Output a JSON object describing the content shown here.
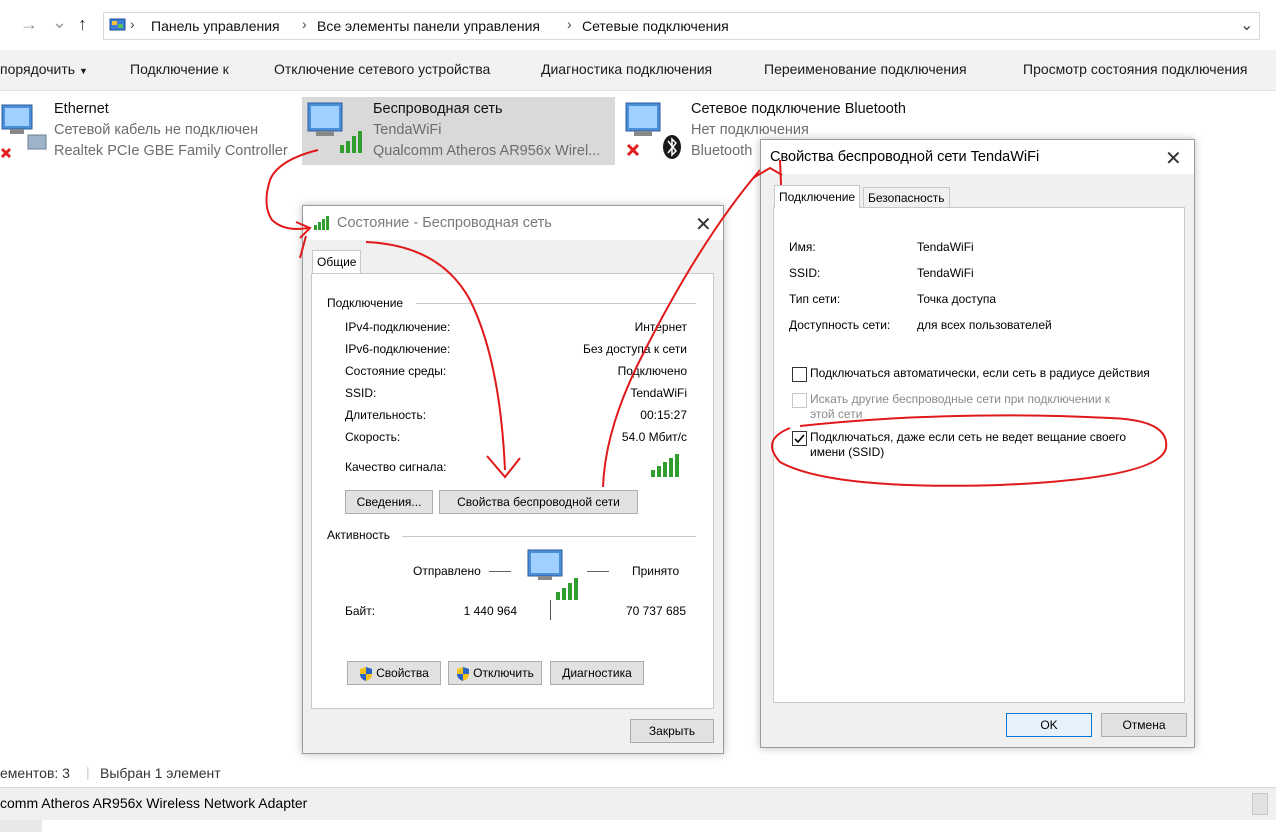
{
  "addressbar": {
    "back_arrow": "→",
    "dropdown": "⌄",
    "up_arrow": "↑",
    "crumbs": [
      "Панель управления",
      "Все элементы панели управления",
      "Сетевые подключения"
    ],
    "separator": "›"
  },
  "toolbar": {
    "organize": "порядочить",
    "connect": "Подключение к",
    "disable": "Отключение сетевого устройства",
    "diagnose": "Диагностика подключения",
    "rename": "Переименование подключения",
    "view_status": "Просмотр состояния подключения"
  },
  "connections": [
    {
      "name": "Ethernet",
      "status": "Сетевой кабель не подключен",
      "device": "Realtek PCIe GBE Family Controller",
      "icon": "ethernet-adapter-icon"
    },
    {
      "name": "Беспроводная сеть",
      "status": "TendaWiFi",
      "device": "Qualcomm Atheros AR956x Wirel...",
      "icon": "wireless-adapter-icon"
    },
    {
      "name": "Сетевое подключение Bluetooth",
      "status": "Нет подключения",
      "device": "Bluetooth",
      "icon": "bluetooth-adapter-icon"
    }
  ],
  "statusbar": {
    "count": "ементов: 3",
    "selected": "Выбран 1 элемент"
  },
  "detailbar": {
    "text": "comm Atheros AR956x Wireless Network Adapter"
  },
  "status_dialog": {
    "title": "Состояние - Беспроводная сеть",
    "tab": "Общие",
    "connection_header": "Подключение",
    "rows": [
      {
        "label": "IPv4-подключение:",
        "value": "Интернет"
      },
      {
        "label": "IPv6-подключение:",
        "value": "Без доступа к сети"
      },
      {
        "label": "Состояние среды:",
        "value": "Подключено"
      },
      {
        "label": "SSID:",
        "value": "TendaWiFi"
      },
      {
        "label": "Длительность:",
        "value": "00:15:27"
      },
      {
        "label": "Скорость:",
        "value": "54.0 Мбит/с"
      }
    ],
    "signal_label": "Качество сигнала:",
    "details_button": "Сведения...",
    "wireless_props_button": "Свойства беспроводной сети",
    "activity_header": "Активность",
    "sent_label": "Отправлено",
    "received_label": "Принято",
    "bytes_label": "Байт:",
    "bytes_sent": "1 440 964",
    "bytes_received": "70 737 685",
    "properties_button": "Свойства",
    "disable_button": "Отключить",
    "diagnose_button": "Диагностика",
    "close_button": "Закрыть"
  },
  "props_dialog": {
    "title": "Свойства беспроводной сети TendaWiFi",
    "tab_connection": "Подключение",
    "tab_security": "Безопасность",
    "rows": [
      {
        "label": "Имя:",
        "value": "TendaWiFi"
      },
      {
        "label": "SSID:",
        "value": "TendaWiFi"
      },
      {
        "label": "Тип сети:",
        "value": "Точка доступа"
      },
      {
        "label": "Доступность сети:",
        "value": "для всех пользователей"
      }
    ],
    "check_auto": "Подключаться автоматически, если сеть в радиусе действия",
    "check_auto_checked": false,
    "check_other_line1": "Искать другие беспроводные сети при подключении к",
    "check_other_line2": "этой сети",
    "check_other_checked": false,
    "check_hidden_line1": "Подключаться, даже если сеть не ведет вещание своего",
    "check_hidden_line2": "имени (SSID)",
    "check_hidden_checked": true,
    "ok_button": "OK",
    "cancel_button": "Отмена"
  },
  "colors": {
    "annotation_red": "#e0191b",
    "selection": "#d9d9d9",
    "signal_green": "#2f9e2f",
    "accent_blue": "#0078d7"
  }
}
